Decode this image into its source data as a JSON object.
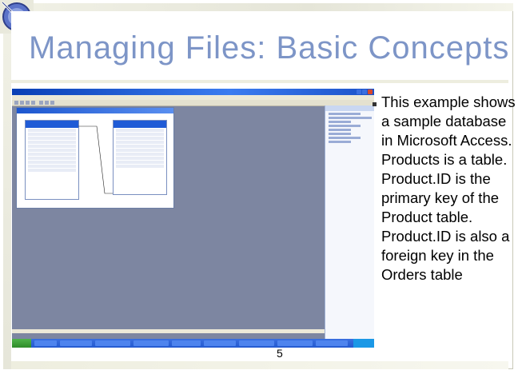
{
  "slide": {
    "title": "Managing Files: Basic Concepts",
    "body": "This example shows a sample database in Microsoft Access. Products is a table. Product.ID is the primary key of the Product table. Product.ID is also a foreign key in the Orders table",
    "page_number": "5"
  },
  "colors": {
    "title": "#7d95c7",
    "access_background": "#7d86a1",
    "xp_blue": "#245ad0",
    "start_green": "#2f8c2a"
  },
  "icons": [
    "corner-ornament-icon",
    "start-button-icon"
  ]
}
